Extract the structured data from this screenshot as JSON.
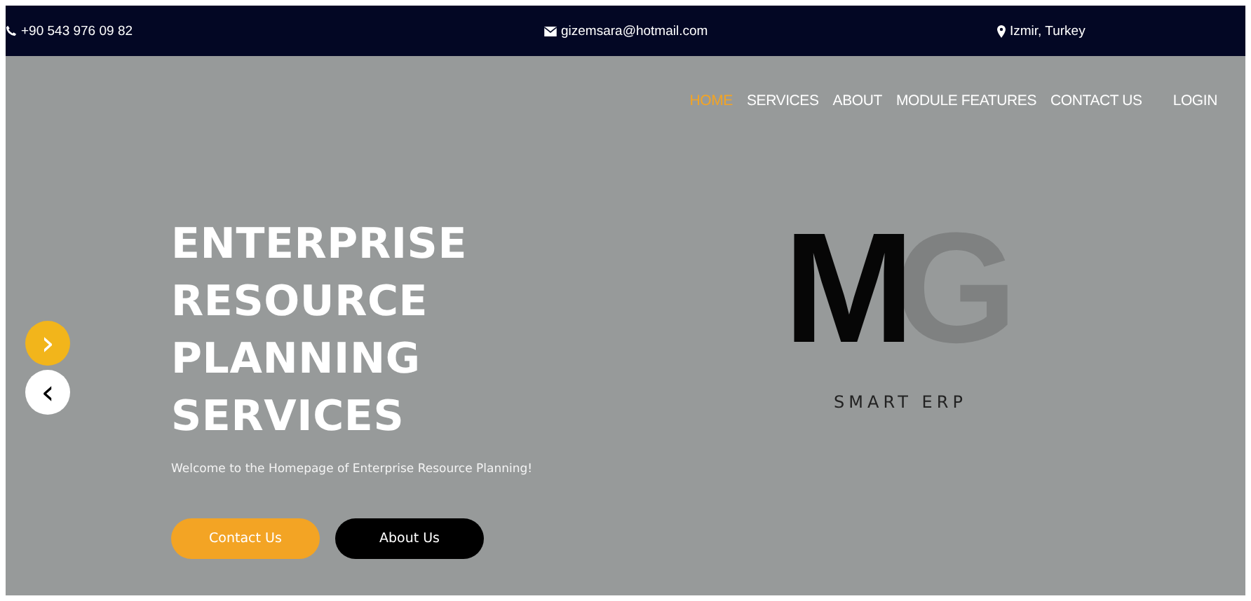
{
  "top_bar": {
    "phone": "+90 543 976 09 82",
    "email": "gizemsara@hotmail.com",
    "location": "Izmir, Turkey"
  },
  "nav": [
    {
      "label": "HOME",
      "selected": true
    },
    {
      "label": "SERVICES",
      "selected": false
    },
    {
      "label": "ABOUT",
      "selected": false
    },
    {
      "label": "MODULE FEATURES",
      "selected": false
    },
    {
      "label": "CONTACT US",
      "selected": false
    },
    {
      "label": "LOGIN",
      "selected": false
    }
  ],
  "hero": {
    "title_lines": [
      "ENTERPRISE",
      "RESOURCE",
      "PLANNING",
      "SERVICES"
    ],
    "subtitle": "Welcome to the Homepage of Enterprise Resource Planning!",
    "buttons": [
      {
        "label": "Contact Us",
        "kind": "primary"
      },
      {
        "label": "About Us",
        "kind": "dark"
      }
    ]
  },
  "carousel": {
    "next": "›",
    "prev": "‹"
  },
  "logo": {
    "letters": [
      "M",
      "G"
    ],
    "caption": "SMART ERP"
  }
}
